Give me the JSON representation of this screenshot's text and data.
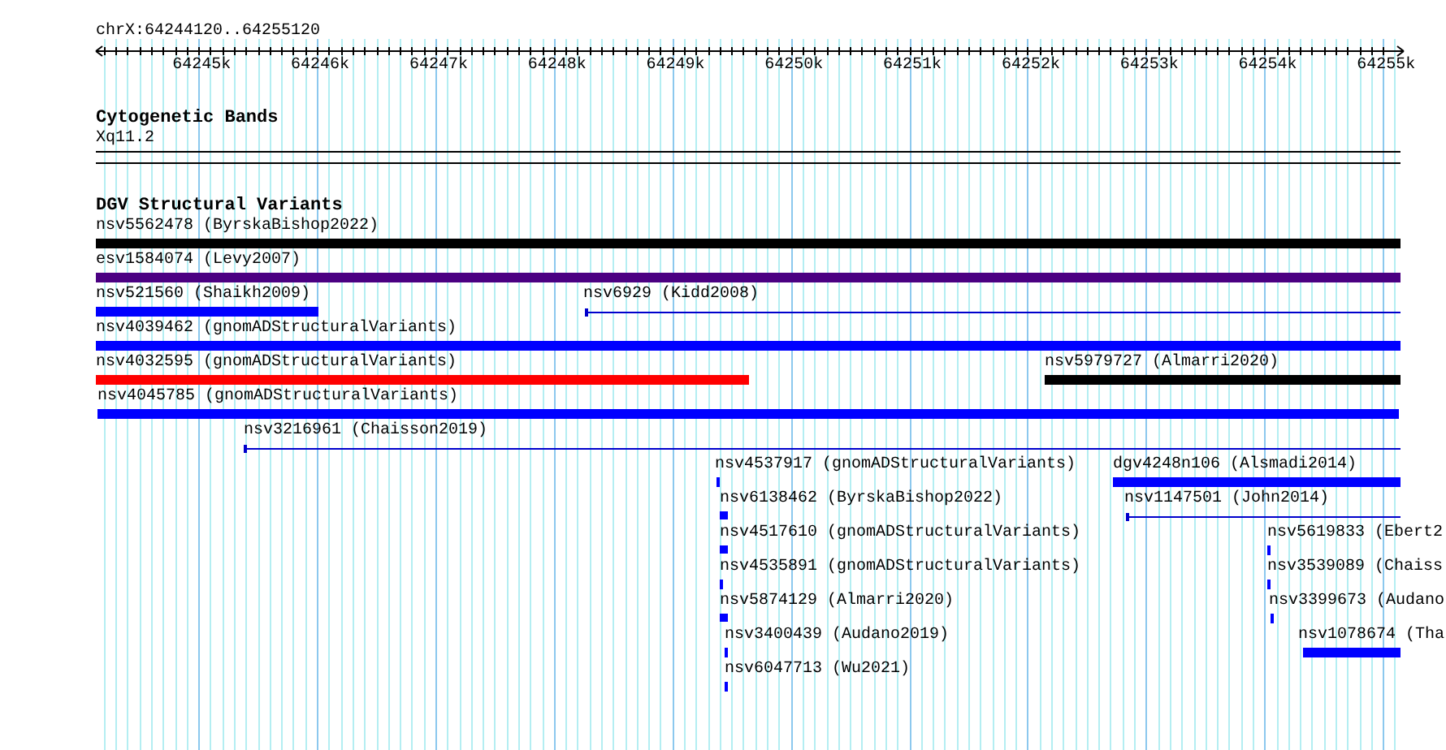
{
  "ruler": {
    "position": "chrX:64244120..64255120",
    "ticks": [
      "64245k",
      "64246k",
      "64247k",
      "64248k",
      "64249k",
      "64250k",
      "64251k",
      "64252k",
      "64253k",
      "64254k",
      "64255k"
    ]
  },
  "cytogenetic_bands": {
    "title": "Cytogenetic Bands",
    "bands": [
      {
        "label": "Xq11.2"
      }
    ]
  },
  "dgv_track": {
    "title": "DGV Structural Variants",
    "variants": [
      {
        "label": "nsv5562478 (ByrskaBishop2022)",
        "kind": "bar",
        "color": "#000000"
      },
      {
        "label": "esv1584074 (Levy2007)",
        "kind": "bar",
        "color": "#4b0082"
      },
      {
        "label": "nsv521560 (Shaikh2009)",
        "kind": "bar",
        "color": "#0000ff"
      },
      {
        "label": "nsv6929 (Kidd2008)",
        "kind": "line",
        "color": "#0000cc"
      },
      {
        "label": "nsv4039462 (gnomADStructuralVariants)",
        "kind": "bar",
        "color": "#0000ff"
      },
      {
        "label": "nsv4032595 (gnomADStructuralVariants)",
        "kind": "bar",
        "color": "#ff0000"
      },
      {
        "label": "nsv5979727 (Almarri2020)",
        "kind": "bar",
        "color": "#000000"
      },
      {
        "label": "nsv4045785 (gnomADStructuralVariants)",
        "kind": "bar",
        "color": "#0000ff"
      },
      {
        "label": "nsv3216961 (Chaisson2019)",
        "kind": "line",
        "color": "#0000cc"
      },
      {
        "label": "nsv4537917 (gnomADStructuralVariants)",
        "kind": "tick",
        "color": "#0000ff"
      },
      {
        "label": "dgv4248n106 (Alsmadi2014)",
        "kind": "bar",
        "color": "#0000ff"
      },
      {
        "label": "nsv6138462 (ByrskaBishop2022)",
        "kind": "square",
        "color": "#0000ff"
      },
      {
        "label": "nsv1147501 (John2014)",
        "kind": "line",
        "color": "#0000cc"
      },
      {
        "label": "nsv4517610 (gnomADStructuralVariants)",
        "kind": "square",
        "color": "#0000ff"
      },
      {
        "label": "nsv5619833 (Ebert2",
        "kind": "tick",
        "color": "#0000ff"
      },
      {
        "label": "nsv4535891 (gnomADStructuralVariants)",
        "kind": "tick",
        "color": "#0000ff"
      },
      {
        "label": "nsv3539089 (Chaiss",
        "kind": "tick",
        "color": "#0000ff"
      },
      {
        "label": "nsv5874129 (Almarri2020)",
        "kind": "square",
        "color": "#0000ff"
      },
      {
        "label": "nsv3399673 (Audano",
        "kind": "tick",
        "color": "#0000ff"
      },
      {
        "label": "nsv3400439 (Audano2019)",
        "kind": "tick",
        "color": "#0000ff"
      },
      {
        "label": "nsv1078674 (Tha",
        "kind": "bar",
        "color": "#0000ff"
      },
      {
        "label": "nsv6047713 (Wu2021)",
        "kind": "tick",
        "color": "#0000ff"
      }
    ]
  }
}
